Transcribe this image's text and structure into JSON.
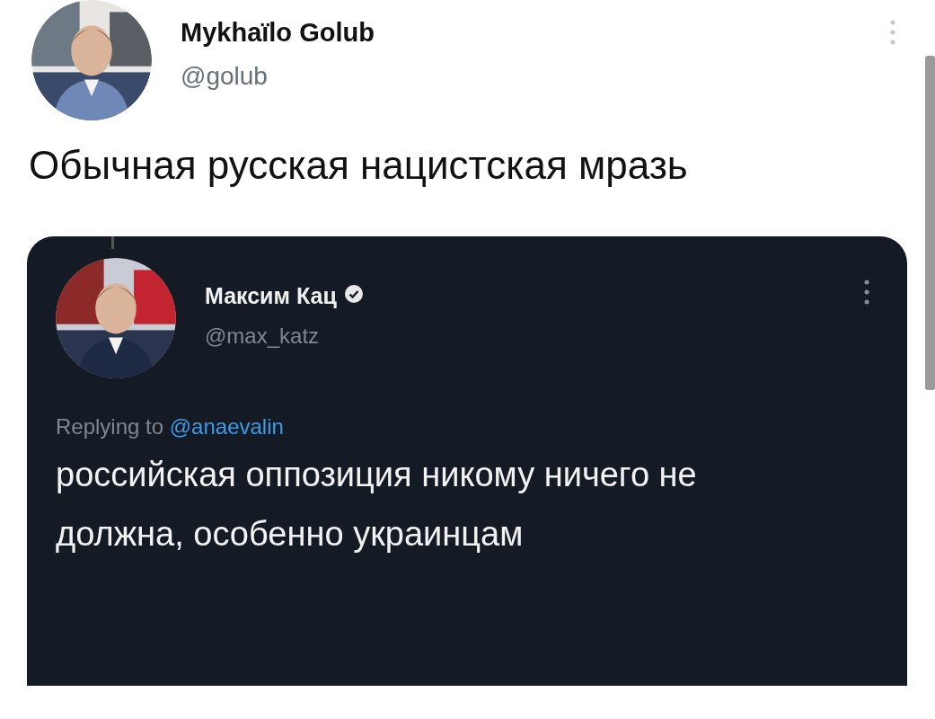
{
  "tweet": {
    "author": {
      "name": "Mykhaïlo Golub",
      "handle": "@golub"
    },
    "text": "Обычная русская нацистская мразь",
    "quoted": {
      "author": {
        "name": "Максим Кац",
        "handle": "@max_katz",
        "verified": true
      },
      "reply_prefix": "Replying to",
      "reply_to": "@anaevalin",
      "text": "российская оппозиция никому ничего не должна, особенно украинцам"
    }
  }
}
